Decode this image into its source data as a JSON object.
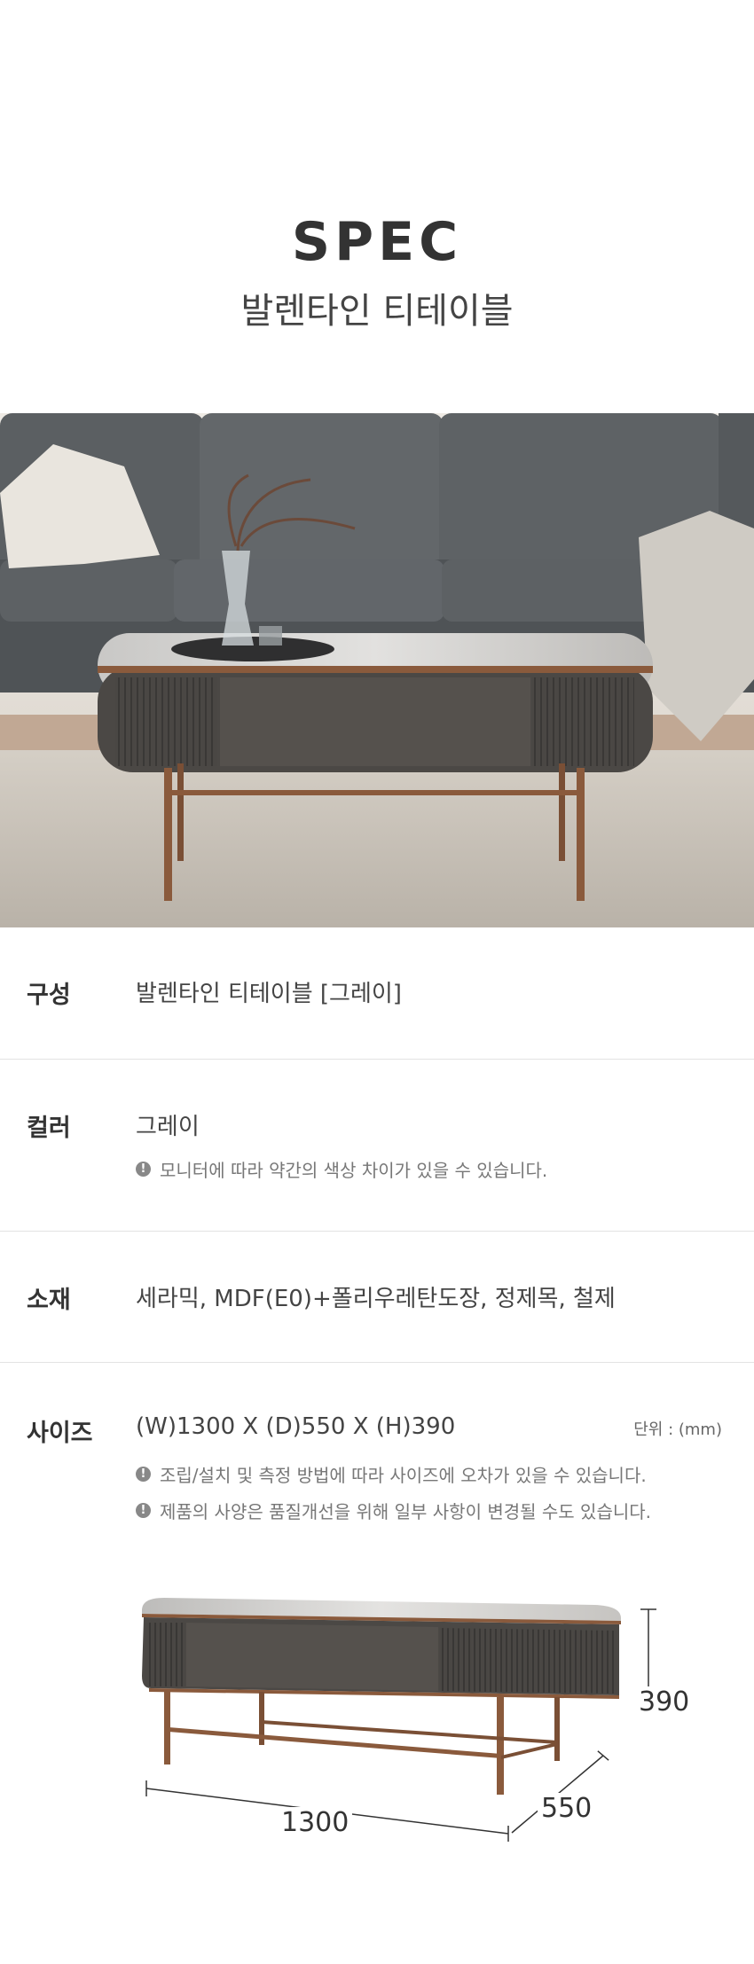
{
  "header": {
    "title": "SPEC",
    "subtitle": "발렌타인 티테이블"
  },
  "specs": {
    "composition": {
      "label": "구성",
      "value": "발렌타인 티테이블 [그레이]"
    },
    "color": {
      "label": "컬러",
      "value": "그레이",
      "note": "모니터에 따라 약간의 색상 차이가 있을 수 있습니다."
    },
    "material": {
      "label": "소재",
      "value": "세라믹, MDF(E0)+폴리우레탄도장, 정제목, 철제"
    },
    "size": {
      "label": "사이즈",
      "value": "(W)1300 X (D)550 X (H)390",
      "unit": "단위 : (mm)",
      "notes": [
        "조립/설치 및 측정 방법에 따라 사이즈에 오차가 있을 수 있습니다.",
        "제품의 사양은 품질개선을 위해 일부 사항이 변경될 수도 있습니다."
      ]
    }
  },
  "dimensions": {
    "width": "1300",
    "depth": "550",
    "height": "390"
  },
  "note_icon": "exclamation-icon",
  "colors": {
    "frame": "#8a5a3c",
    "body": "#4b4845",
    "sofa": "#5a5e61",
    "rug": "#cfc9c0"
  }
}
